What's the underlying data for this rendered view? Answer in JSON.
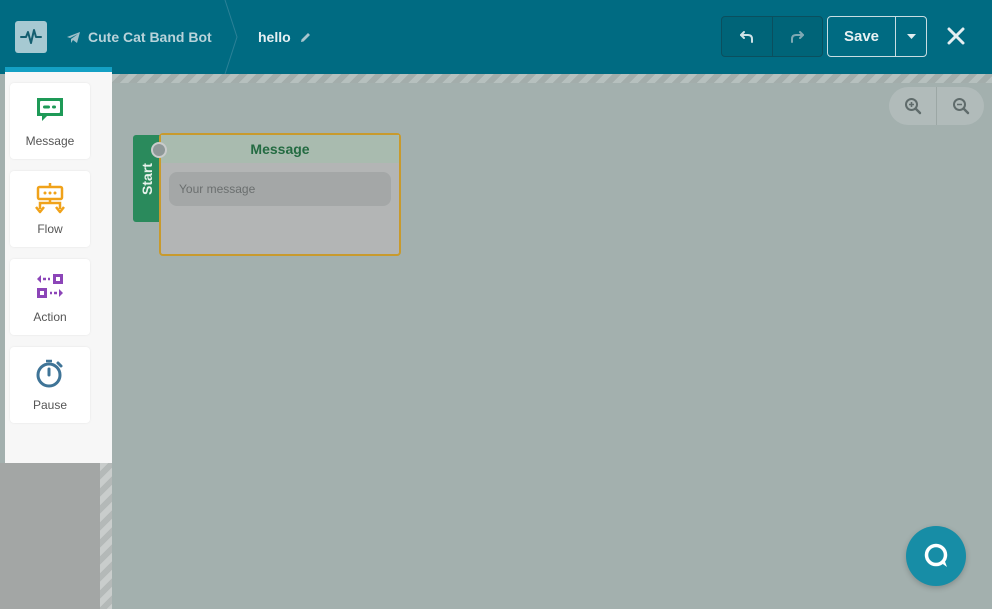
{
  "header": {
    "bot_name": "Cute Cat Band Bot",
    "flow_name": "hello",
    "save_label": "Save"
  },
  "toolbox": {
    "items": [
      {
        "label": "Message",
        "icon": "message-icon",
        "color": "#1e9a57"
      },
      {
        "label": "Flow",
        "icon": "flow-icon",
        "color": "#f0a21a"
      },
      {
        "label": "Action",
        "icon": "action-icon",
        "color": "#8c45b8"
      },
      {
        "label": "Pause",
        "icon": "timer-icon",
        "color": "#3f7497"
      }
    ]
  },
  "node": {
    "start_label": "Start",
    "title": "Message",
    "placeholder": "Your message"
  },
  "colors": {
    "header": "#006b82",
    "accent": "#14a0c4",
    "node_border": "#c89a2d",
    "start": "#2a8a5c"
  }
}
